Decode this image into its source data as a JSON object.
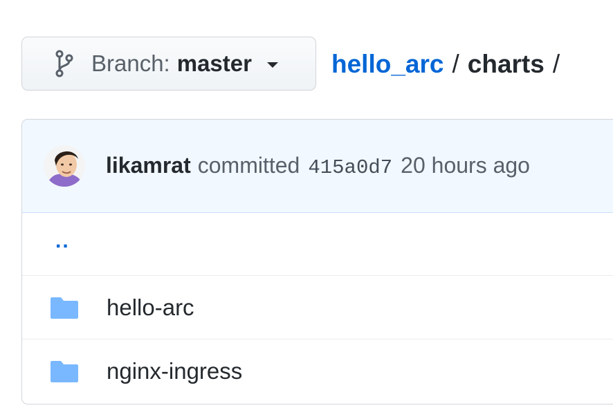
{
  "branch": {
    "label": "Branch:",
    "name": "master",
    "icon": "git-branch-icon"
  },
  "breadcrumb": {
    "repo": "hello_arc",
    "separator": "/",
    "current": "charts",
    "trailing": "/"
  },
  "commit": {
    "author": "likamrat",
    "verb": "committed",
    "sha": "415a0d7",
    "age": "20 hours ago"
  },
  "files": {
    "parent_link": "..",
    "items": [
      {
        "name": "hello-arc",
        "type": "folder",
        "icon": "folder-icon"
      },
      {
        "name": "nginx-ingress",
        "type": "folder",
        "icon": "folder-icon"
      }
    ]
  },
  "colors": {
    "link": "#0366d6",
    "folder": "#79b8ff",
    "commit_bg": "#f1f8ff"
  }
}
